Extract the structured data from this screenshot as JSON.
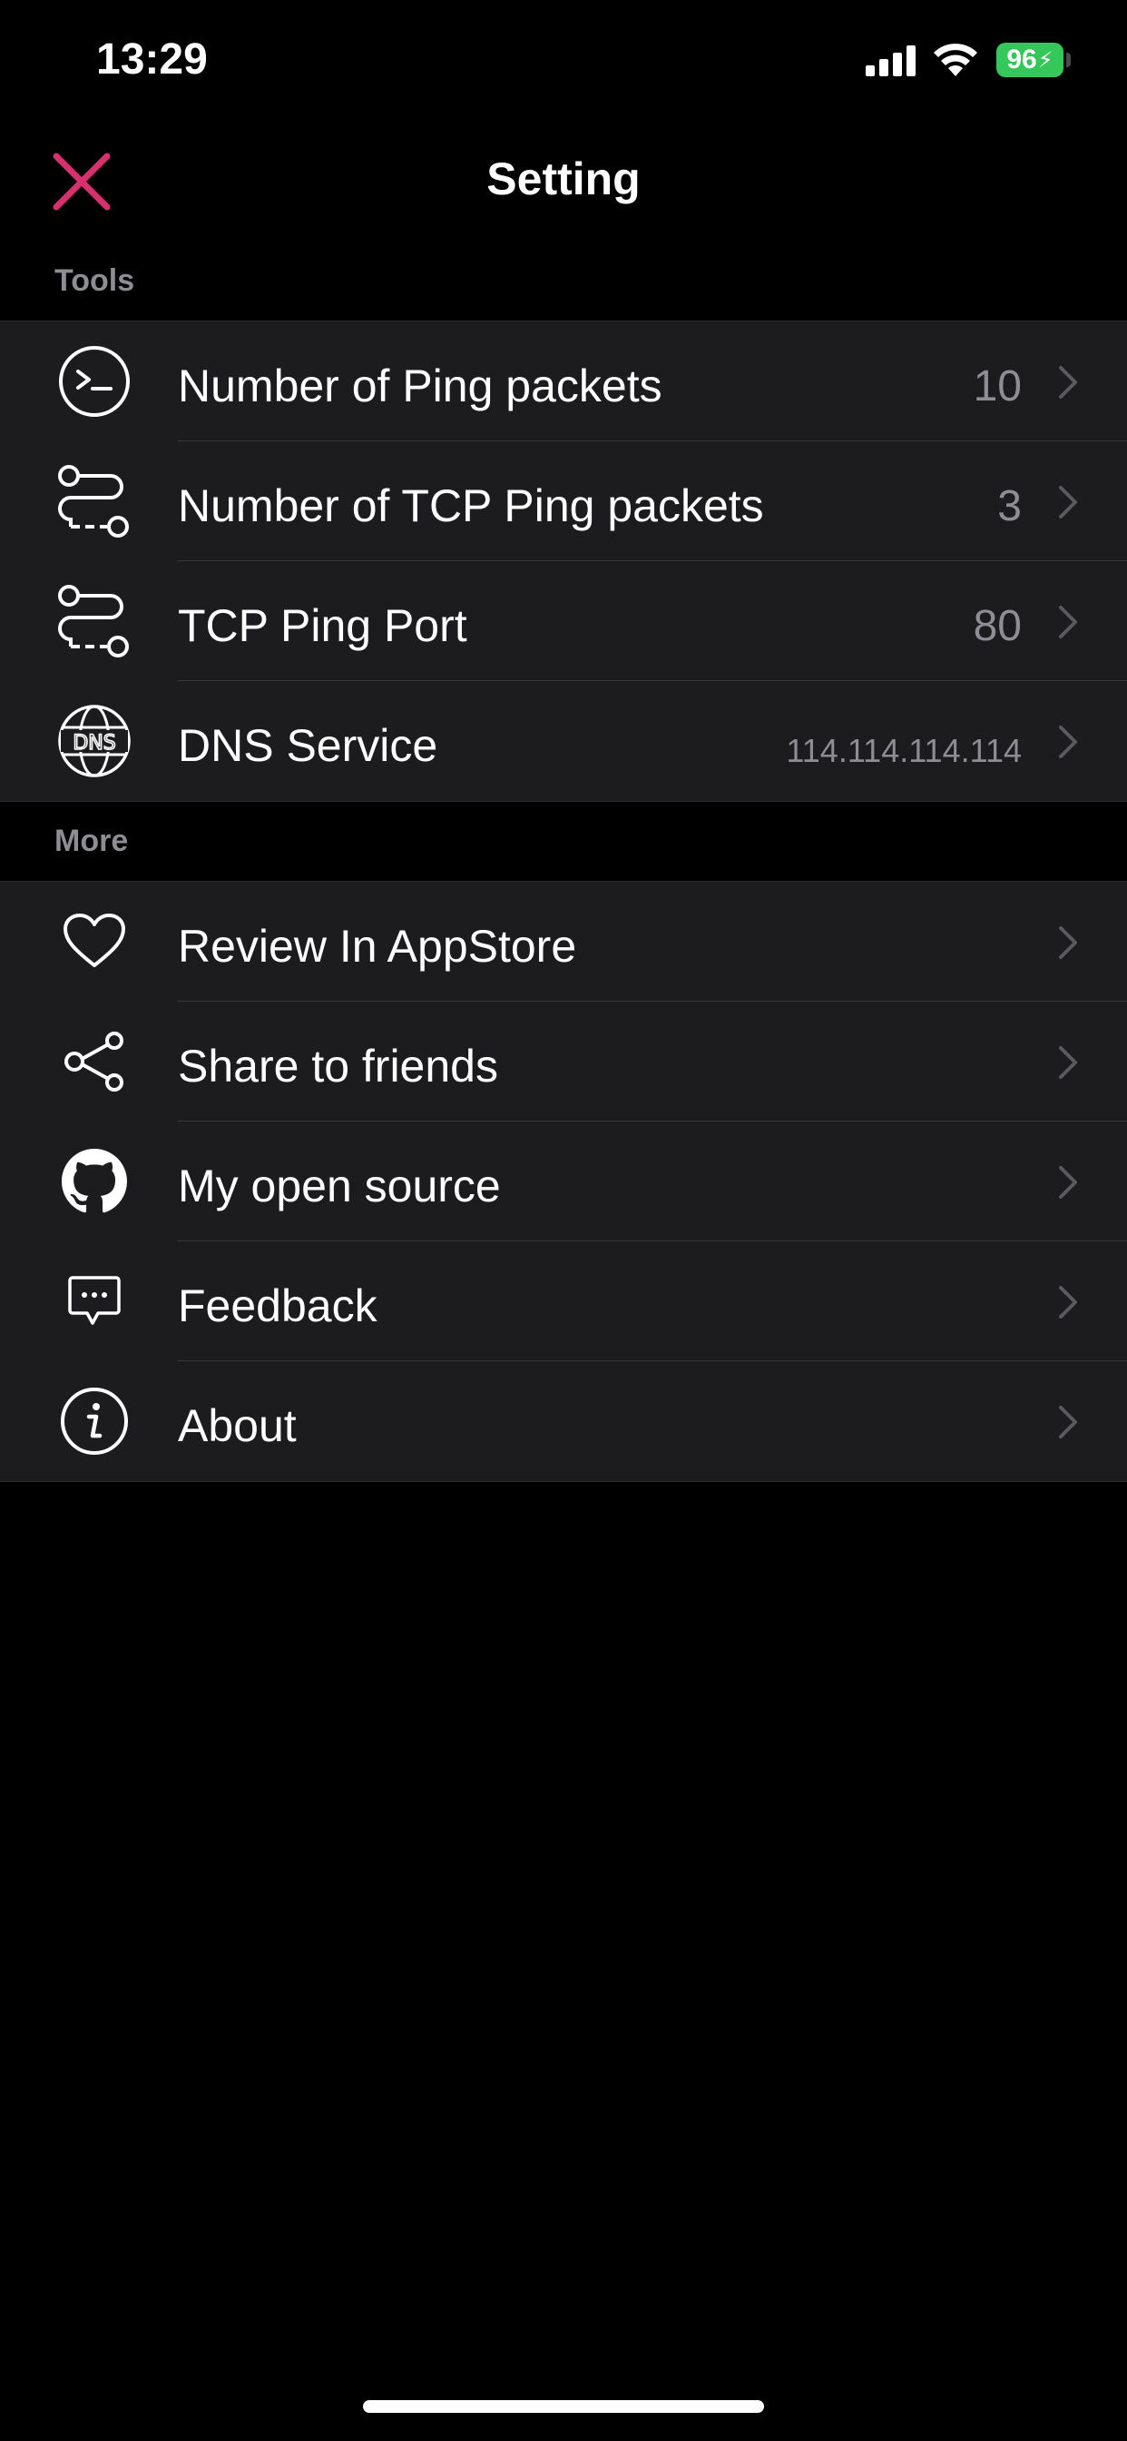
{
  "status_bar": {
    "time": "13:29",
    "battery": "96",
    "signal_icon": "cellular-signal-icon",
    "wifi_icon": "wifi-icon",
    "battery_color": "#35c759"
  },
  "nav": {
    "title": "Setting",
    "close_icon": "close-icon",
    "accent_color": "#d6306e"
  },
  "sections": {
    "tools": {
      "header": "Tools",
      "items": [
        {
          "label": "Number of Ping packets",
          "value": "10",
          "icon": "terminal-icon"
        },
        {
          "label": "Number of TCP Ping packets",
          "value": "3",
          "icon": "connection-icon"
        },
        {
          "label": "TCP Ping Port",
          "value": "80",
          "icon": "connection-icon"
        },
        {
          "label": "DNS Service",
          "value": "114.114.114.114",
          "icon": "dns-globe-icon"
        }
      ]
    },
    "more": {
      "header": "More",
      "items": [
        {
          "label": "Review In AppStore",
          "icon": "heart-icon"
        },
        {
          "label": "Share to friends",
          "icon": "share-icon"
        },
        {
          "label": "My open source",
          "icon": "github-icon"
        },
        {
          "label": "Feedback",
          "icon": "chat-bubble-icon"
        },
        {
          "label": "About",
          "icon": "info-icon"
        }
      ]
    }
  }
}
